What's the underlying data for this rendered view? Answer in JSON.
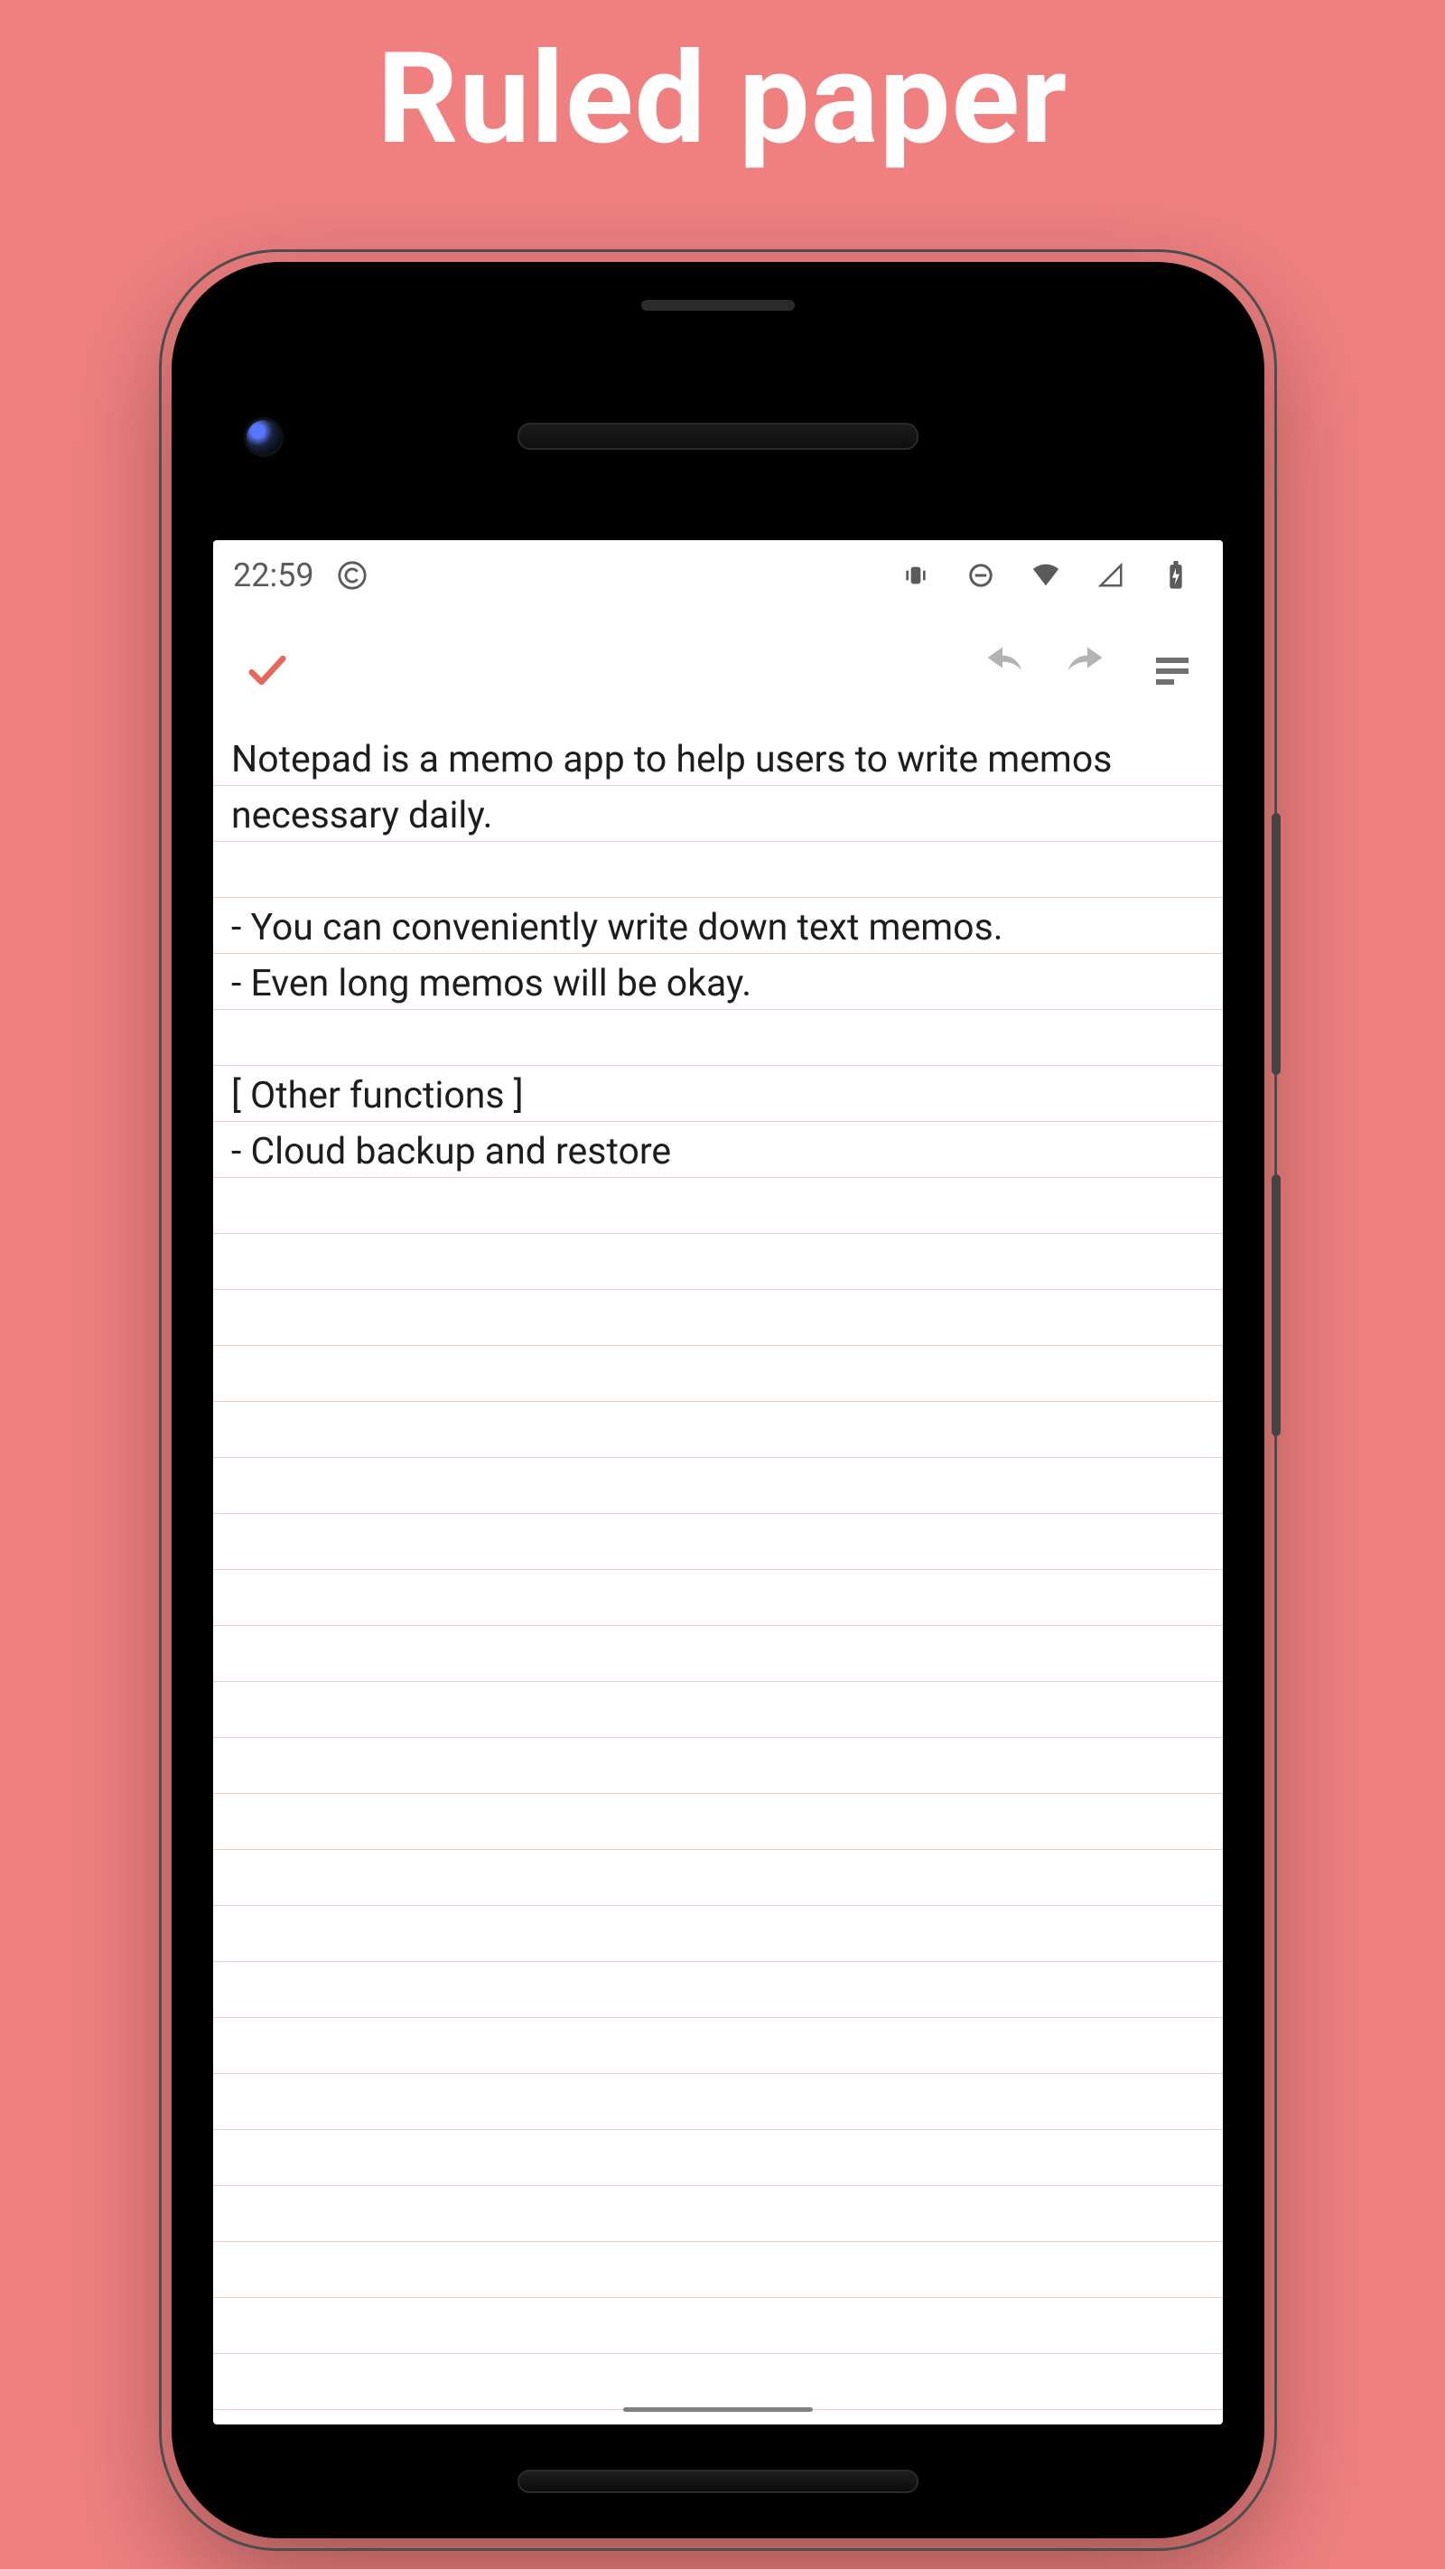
{
  "hero": {
    "title": "Ruled paper"
  },
  "status": {
    "time": "22:59"
  },
  "colors": {
    "accent": "#e3695a",
    "muted_icon": "#b3b3b3",
    "status_icon": "#5b5b5b"
  },
  "note": {
    "lines": [
      "Notepad is a memo app to help users to write memos necessary daily.",
      "",
      "- You can conveniently write down text memos.",
      "- Even long memos will be okay.",
      "",
      "[ Other functions ]",
      "- Cloud backup and restore"
    ]
  }
}
